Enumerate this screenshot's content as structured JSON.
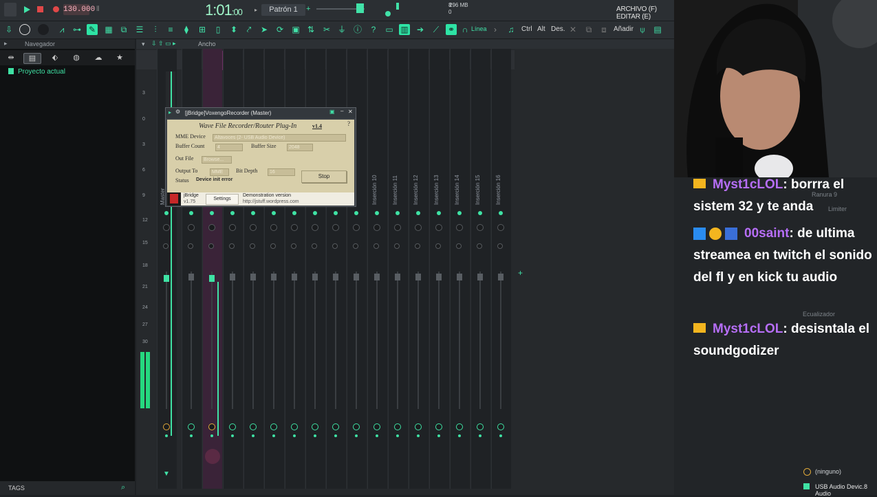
{
  "transport": {
    "tempo": "130.000",
    "time_main": "1:01",
    "time_sub": ":00",
    "pattern": "Patrón 1",
    "mem_mb": "296 MB",
    "mem_count": "8",
    "mem_zero": "0",
    "menu_right": "ARCHIVO (F) EDITAR (E)"
  },
  "toolbar": {
    "linea": "Línea",
    "ctrl": "Ctrl",
    "alt": "Alt",
    "des": "Des.",
    "anadir": "Añadir"
  },
  "browser": {
    "header": "Navegador",
    "project_item": "Proyecto actual",
    "tags": "TAGS"
  },
  "mixer": {
    "header_label": "Ancho",
    "master_label": "Master",
    "insert_labels": [
      "Inserción 10",
      "Inserción 11",
      "Inserción 12",
      "Inserción 13",
      "Inserción 14",
      "Inserción 15",
      "Inserción 16"
    ],
    "scale": [
      "3",
      "0",
      "3",
      "6",
      "9",
      "12",
      "15",
      "18",
      "21",
      "24",
      "27",
      "30"
    ],
    "slot_label": "Ranura 9",
    "limiter": "Limiter",
    "ecualizador": "Ecualizador",
    "ninguno": "(ninguno)",
    "device": "USB Audio Devic.8 Audio"
  },
  "plugin": {
    "title": "[jBridge]VoxengoRecorder (Master)",
    "heading": "Wave File Recorder/Router Plug-In",
    "version": "v1.4",
    "mme_label": "MME Device",
    "mme_value": "Altavoces (2- USB Audio Device)",
    "buffer_count_label": "Buffer Count",
    "buffer_count_value": "4",
    "buffer_size_label": "Buffer Size",
    "buffer_size_value": "2048",
    "out_file_label": "Out File",
    "out_file_value": "Browse...",
    "output_to_label": "Output To",
    "output_to_value": "MME",
    "bit_depth_label": "Bit Depth",
    "bit_depth_value": "16",
    "status_label": "Status",
    "status_value": "Device init error",
    "stop": "Stop",
    "jbridge_name": "jBridge",
    "jbridge_ver": "v1.75",
    "settings": "Settings",
    "demo": "Demonstration version",
    "url": "http://jstuff.wordpress.com"
  },
  "chat": [
    {
      "user": "Myst1cLOL",
      "text": ": borrra el sistem 32 y te anda"
    },
    {
      "user": "00saint",
      "text": ": de ultima streamea en twitch el sonido del fl y en kick tu audio"
    },
    {
      "user": "Myst1cLOL",
      "text": ": desisntala el soundgodizer"
    }
  ],
  "colors": {
    "accent": "#3fe2a4",
    "chat_user": "#b66ef7",
    "plugin_bg": "#d8cfaa"
  }
}
